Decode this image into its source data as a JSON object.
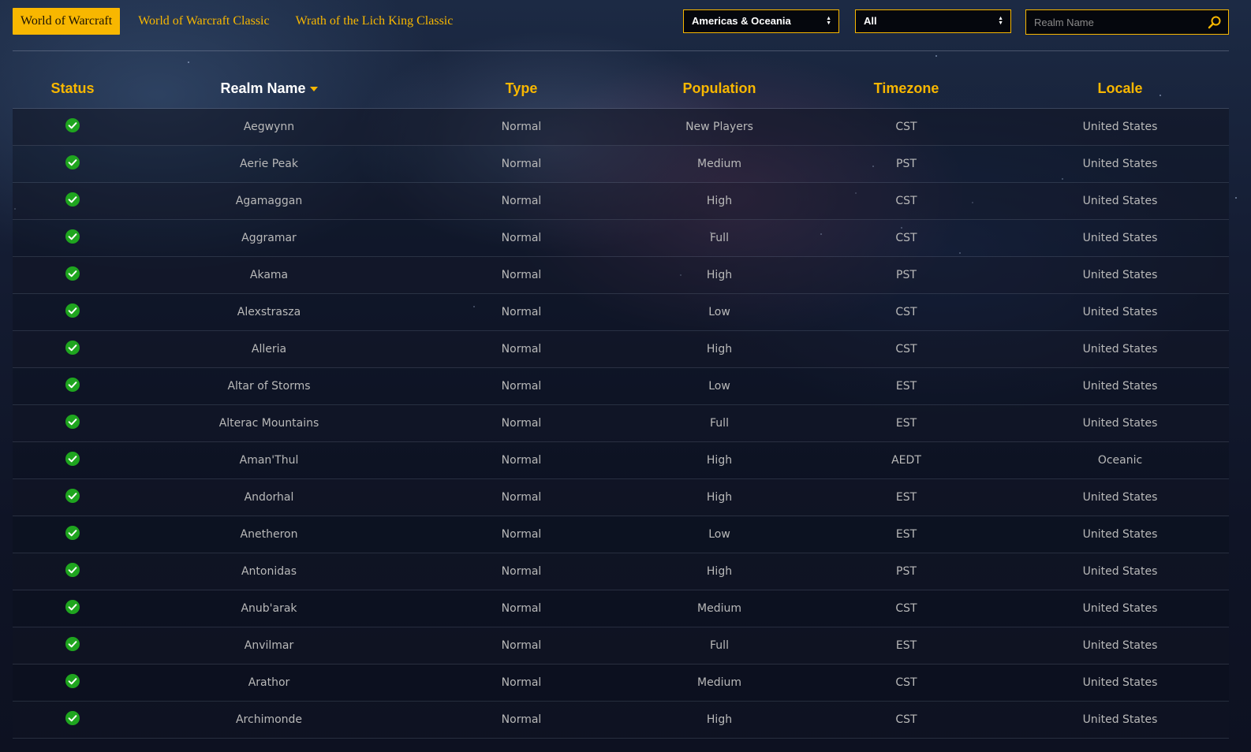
{
  "game_tabs": [
    {
      "label": "World of Warcraft",
      "active": true
    },
    {
      "label": "World of Warcraft Classic",
      "active": false
    },
    {
      "label": "Wrath of the Lich King Classic",
      "active": false
    }
  ],
  "filters": {
    "region": "Americas & Oceania",
    "type": "All",
    "search_placeholder": "Realm Name",
    "search_value": ""
  },
  "colors": {
    "accent": "#f8b700",
    "status_up": "#1fa51f"
  },
  "table": {
    "headers": {
      "status": "Status",
      "realm_name": "Realm Name",
      "type": "Type",
      "population": "Population",
      "timezone": "Timezone",
      "locale": "Locale"
    },
    "sorted_by": "realm_name",
    "sort_direction": "ascending",
    "rows": [
      {
        "status": "up",
        "status_icon": "check-circle-icon",
        "name": "Aegwynn",
        "type": "Normal",
        "population": "New Players",
        "timezone": "CST",
        "locale": "United States"
      },
      {
        "status": "up",
        "status_icon": "check-circle-icon",
        "name": "Aerie Peak",
        "type": "Normal",
        "population": "Medium",
        "timezone": "PST",
        "locale": "United States"
      },
      {
        "status": "up",
        "status_icon": "check-circle-icon",
        "name": "Agamaggan",
        "type": "Normal",
        "population": "High",
        "timezone": "CST",
        "locale": "United States"
      },
      {
        "status": "up",
        "status_icon": "check-circle-icon",
        "name": "Aggramar",
        "type": "Normal",
        "population": "Full",
        "timezone": "CST",
        "locale": "United States"
      },
      {
        "status": "up",
        "status_icon": "check-circle-icon",
        "name": "Akama",
        "type": "Normal",
        "population": "High",
        "timezone": "PST",
        "locale": "United States"
      },
      {
        "status": "up",
        "status_icon": "check-circle-icon",
        "name": "Alexstrasza",
        "type": "Normal",
        "population": "Low",
        "timezone": "CST",
        "locale": "United States"
      },
      {
        "status": "up",
        "status_icon": "check-circle-icon",
        "name": "Alleria",
        "type": "Normal",
        "population": "High",
        "timezone": "CST",
        "locale": "United States"
      },
      {
        "status": "up",
        "status_icon": "check-circle-icon",
        "name": "Altar of Storms",
        "type": "Normal",
        "population": "Low",
        "timezone": "EST",
        "locale": "United States"
      },
      {
        "status": "up",
        "status_icon": "check-circle-icon",
        "name": "Alterac Mountains",
        "type": "Normal",
        "population": "Full",
        "timezone": "EST",
        "locale": "United States"
      },
      {
        "status": "up",
        "status_icon": "check-circle-icon",
        "name": "Aman'Thul",
        "type": "Normal",
        "population": "High",
        "timezone": "AEDT",
        "locale": "Oceanic"
      },
      {
        "status": "up",
        "status_icon": "check-circle-icon",
        "name": "Andorhal",
        "type": "Normal",
        "population": "High",
        "timezone": "EST",
        "locale": "United States"
      },
      {
        "status": "up",
        "status_icon": "check-circle-icon",
        "name": "Anetheron",
        "type": "Normal",
        "population": "Low",
        "timezone": "EST",
        "locale": "United States"
      },
      {
        "status": "up",
        "status_icon": "check-circle-icon",
        "name": "Antonidas",
        "type": "Normal",
        "population": "High",
        "timezone": "PST",
        "locale": "United States"
      },
      {
        "status": "up",
        "status_icon": "check-circle-icon",
        "name": "Anub'arak",
        "type": "Normal",
        "population": "Medium",
        "timezone": "CST",
        "locale": "United States"
      },
      {
        "status": "up",
        "status_icon": "check-circle-icon",
        "name": "Anvilmar",
        "type": "Normal",
        "population": "Full",
        "timezone": "EST",
        "locale": "United States"
      },
      {
        "status": "up",
        "status_icon": "check-circle-icon",
        "name": "Arathor",
        "type": "Normal",
        "population": "Medium",
        "timezone": "CST",
        "locale": "United States"
      },
      {
        "status": "up",
        "status_icon": "check-circle-icon",
        "name": "Archimonde",
        "type": "Normal",
        "population": "High",
        "timezone": "CST",
        "locale": "United States"
      }
    ]
  }
}
